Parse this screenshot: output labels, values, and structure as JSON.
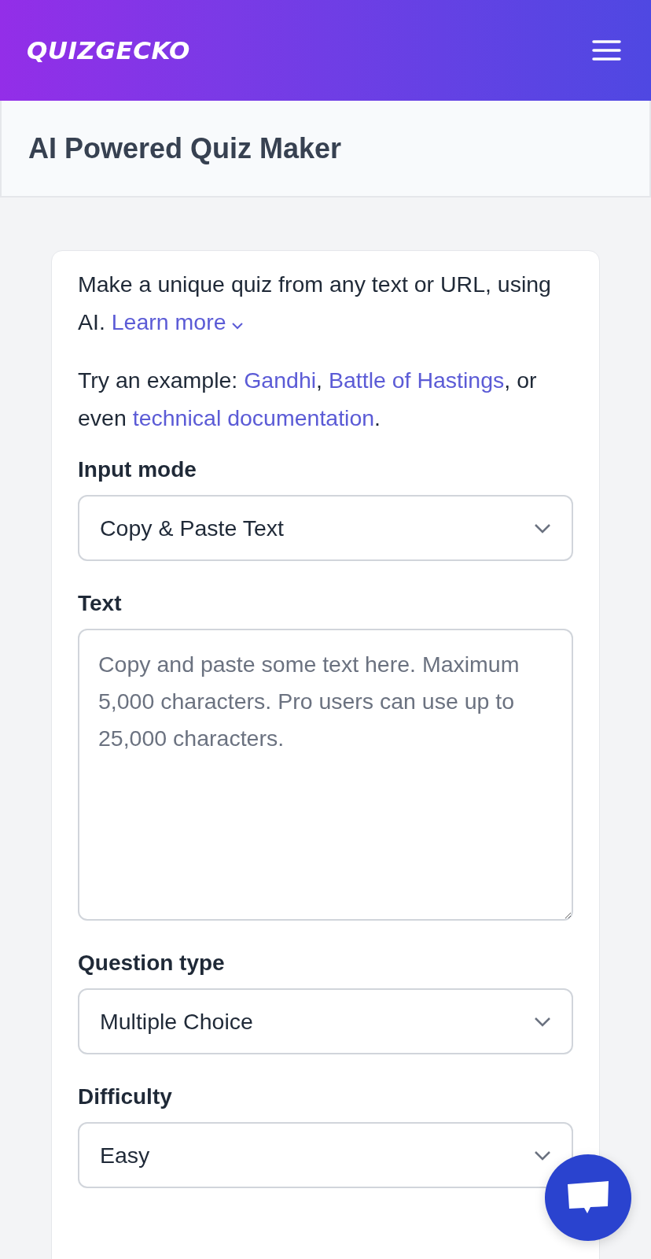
{
  "header": {
    "logo": "QUIZGECKO"
  },
  "page_title": "AI Powered Quiz Maker",
  "intro": [
    {
      "kind": "text",
      "text": "Make a unique quiz from any text or URL, using AI. "
    },
    {
      "kind": "link",
      "text": "Learn more"
    }
  ],
  "examples": [
    {
      "kind": "text",
      "text": "Try an example: "
    },
    {
      "kind": "link",
      "text": "Gandhi"
    },
    {
      "kind": "text",
      "text": ", "
    },
    {
      "kind": "link",
      "text": "Battle of Hastings"
    },
    {
      "kind": "text",
      "text": ", or even "
    },
    {
      "kind": "link",
      "text": "technical documentation"
    },
    {
      "kind": "text",
      "text": "."
    }
  ],
  "fields": [
    {
      "kind": "select",
      "label": "Input mode",
      "value": "Copy & Paste Text"
    },
    {
      "kind": "textarea",
      "label": "Text",
      "placeholder": "Copy and paste some text here. Maximum 5,000 characters. Pro users can use up to 25,000 characters."
    },
    {
      "kind": "select",
      "label": "Question type",
      "value": "Multiple Choice"
    },
    {
      "kind": "select",
      "label": "Difficulty",
      "value": "Easy"
    }
  ]
}
